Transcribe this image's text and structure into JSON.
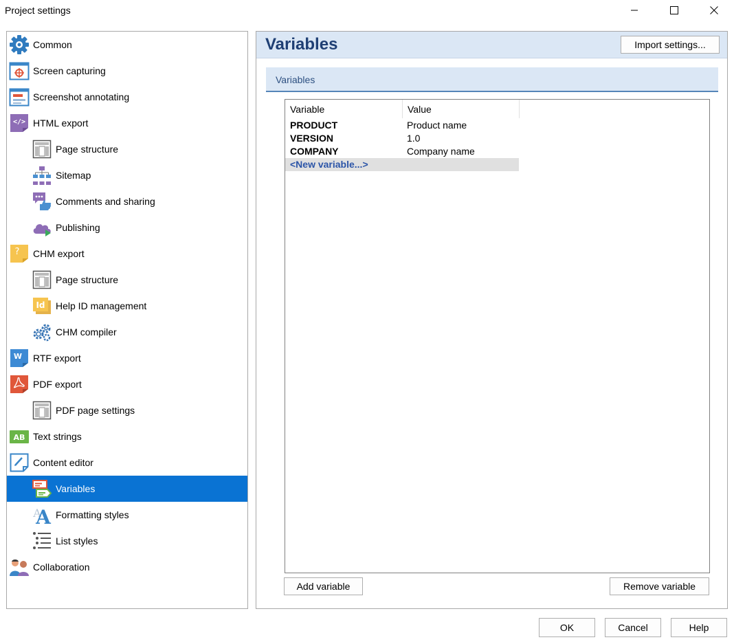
{
  "window": {
    "title": "Project settings"
  },
  "tree": {
    "items": [
      {
        "label": "Common",
        "icon": "gear-icon"
      },
      {
        "label": "Screen capturing",
        "icon": "screen-capture-icon"
      },
      {
        "label": "Screenshot annotating",
        "icon": "annotation-icon"
      },
      {
        "label": "HTML export",
        "icon": "html-code-icon"
      },
      {
        "label": "Page structure",
        "icon": "page-layout-icon"
      },
      {
        "label": "Sitemap",
        "icon": "sitemap-icon"
      },
      {
        "label": "Comments and sharing",
        "icon": "comments-icon"
      },
      {
        "label": "Publishing",
        "icon": "cloud-publish-icon"
      },
      {
        "label": "CHM export",
        "icon": "chm-help-icon"
      },
      {
        "label": "Page structure",
        "icon": "page-layout-icon"
      },
      {
        "label": "Help ID management",
        "icon": "help-id-icon"
      },
      {
        "label": "CHM compiler",
        "icon": "gears-icon"
      },
      {
        "label": "RTF export",
        "icon": "word-doc-icon"
      },
      {
        "label": "PDF export",
        "icon": "pdf-icon"
      },
      {
        "label": "PDF page settings",
        "icon": "page-layout-icon"
      },
      {
        "label": "Text strings",
        "icon": "text-strings-icon"
      },
      {
        "label": "Content editor",
        "icon": "pen-edit-icon"
      },
      {
        "label": "Variables",
        "icon": "variables-icon"
      },
      {
        "label": "Formatting styles",
        "icon": "font-style-icon"
      },
      {
        "label": "List styles",
        "icon": "list-icon"
      },
      {
        "label": "Collaboration",
        "icon": "collaboration-icon"
      }
    ]
  },
  "panel": {
    "title": "Variables",
    "import_label": "Import settings...",
    "group_title": "Variables",
    "columns": {
      "variable": "Variable",
      "value": "Value"
    },
    "rows": [
      {
        "name": "PRODUCT",
        "value": "Product name"
      },
      {
        "name": "VERSION",
        "value": "1.0"
      },
      {
        "name": "COMPANY",
        "value": "Company name"
      }
    ],
    "new_row_label": "<New variable...>",
    "add_label": "Add variable",
    "remove_label": "Remove variable"
  },
  "footer": {
    "ok_label": "OK",
    "cancel_label": "Cancel",
    "help_label": "Help"
  },
  "colors": {
    "selection": "#0a73d3",
    "header_bg": "#dbe7f5",
    "title_text": "#1f3f74"
  }
}
